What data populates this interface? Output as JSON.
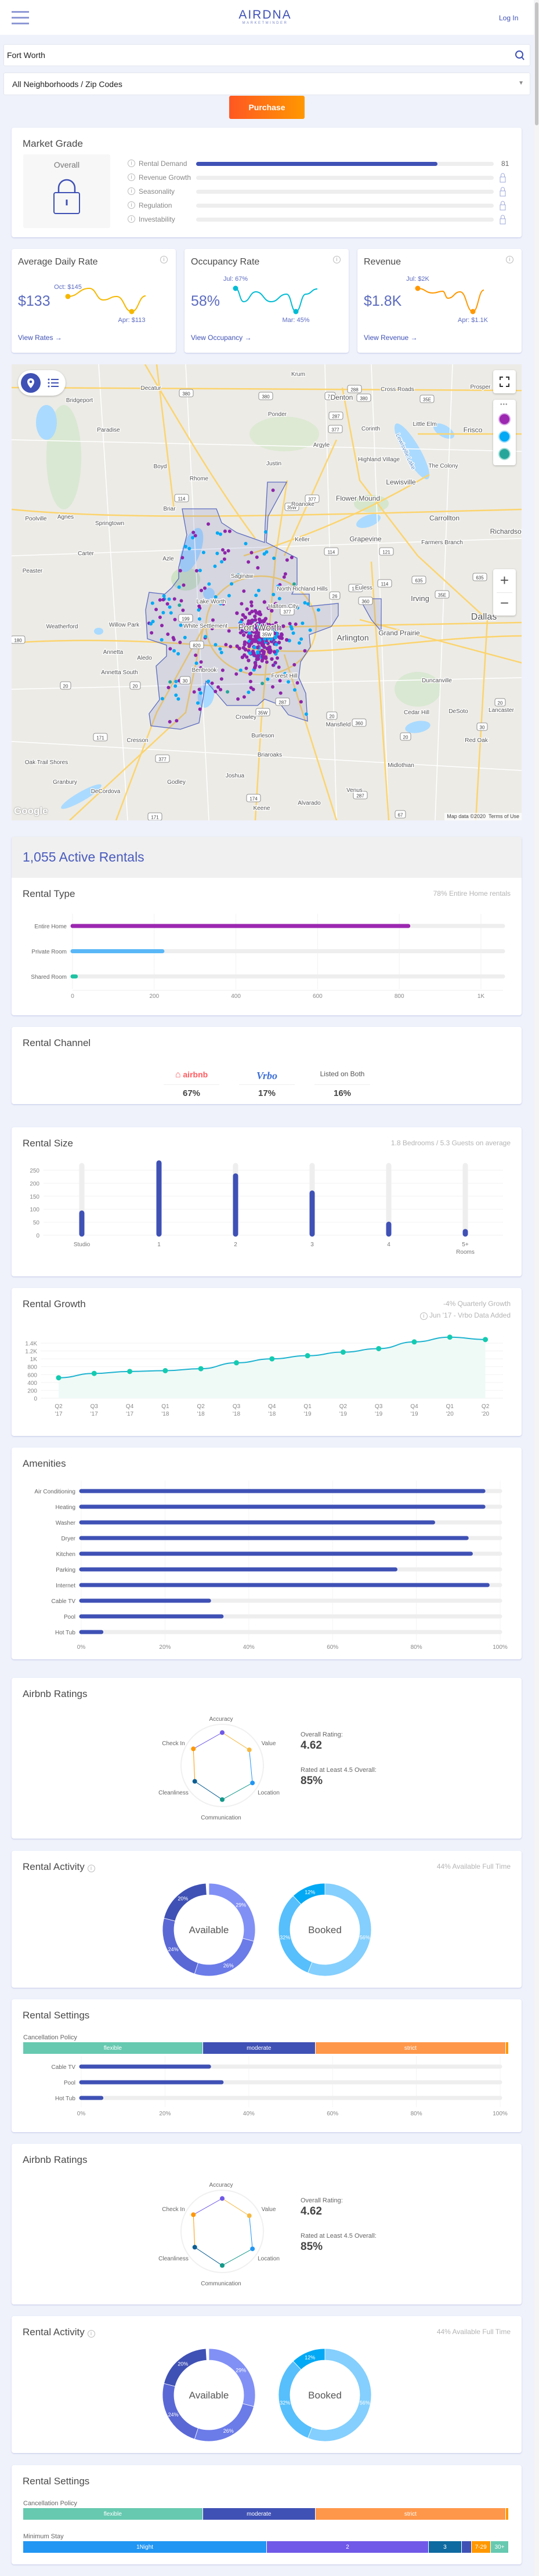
{
  "header": {
    "logo": "AIRDNA",
    "logo_sub": "MARKETMINDER",
    "login": "Log In"
  },
  "search": {
    "value": "Fort Worth"
  },
  "neighborhood": {
    "selected": "All Neighborhoods / Zip Codes"
  },
  "purchase": "Purchase",
  "market_grade": {
    "title": "Market Grade",
    "overall_label": "Overall",
    "rows": [
      {
        "label": "Rental Demand",
        "value": 81,
        "display": "81"
      },
      {
        "label": "Revenue Growth",
        "locked": true
      },
      {
        "label": "Seasonality",
        "locked": true
      },
      {
        "label": "Regulation",
        "locked": true
      },
      {
        "label": "Investability",
        "locked": true
      }
    ]
  },
  "stats": [
    {
      "title": "Average Daily Rate",
      "value": "$133",
      "high": "Oct: $145",
      "low": "Apr: $113",
      "link": "View Rates →",
      "color": "#f5b800"
    },
    {
      "title": "Occupancy Rate",
      "value": "58%",
      "high": "Jul: 67%",
      "low": "Mar: 45%",
      "link": "View Occupancy →",
      "color": "#00bcd4"
    },
    {
      "title": "Revenue",
      "value": "$1.8K",
      "high": "Jul: $2K",
      "low": "Apr: $1.1K",
      "link": "View Revenue →",
      "color": "#ff9800"
    }
  ],
  "map": {
    "labels": [
      "Krum",
      "Decatur",
      "Bridgeport",
      "Denton",
      "Cross Roads",
      "Prosper",
      "Ponder",
      "Corinth",
      "Little Elm",
      "Frisco",
      "Paradise",
      "Argyle",
      "Highland Village",
      "The Colony",
      "Boyd",
      "Justin",
      "Rhome",
      "Lewisville",
      "Flower Mound",
      "Roanoke",
      "Briar",
      "Poolville",
      "Agnes",
      "Springtown",
      "Carrollton",
      "Keller",
      "Grapevine",
      "Farmers Branch",
      "Richardson",
      "Carter",
      "Azle",
      "Peaster",
      "Saginaw",
      "North Richland Hills",
      "Euless",
      "Irving",
      "Lake Worth",
      "Haltom City",
      "Weatherford",
      "Willow Park",
      "White Settlement",
      "Fort Worth",
      "Arlington",
      "Grand Prairie",
      "Dallas",
      "Annetta",
      "Aledo",
      "Benbrook",
      "Annetta South",
      "Forest Hill",
      "Duncanville",
      "Cedar Hill",
      "DeSoto",
      "Lancaster",
      "Crowley",
      "Mansfield",
      "Burleson",
      "Cresson",
      "Red Oak",
      "Briaroaks",
      "Midlothian",
      "Oak Trail Shores",
      "Granbury",
      "Joshua",
      "Godley",
      "DeCordova",
      "Venus",
      "Keene",
      "Alvarado",
      "Lewisville Lake"
    ],
    "shields": [
      "380",
      "380",
      "77",
      "288",
      "380",
      "35E",
      "377",
      "287",
      "114",
      "377",
      "35W",
      "114",
      "121",
      "26",
      "121",
      "360",
      "635",
      "114",
      "35E",
      "635",
      "199",
      "35W",
      "377",
      "180",
      "20",
      "20",
      "820",
      "30",
      "287",
      "35W",
      "20",
      "20",
      "360",
      "30",
      "20",
      "171",
      "377",
      "174",
      "171",
      "287",
      "67",
      "377",
      "67",
      "35E"
    ],
    "attribution": "Map data ©2020",
    "terms": "Terms of Use",
    "google": "Google",
    "dot_colors": {
      "entire_home": "#8e24aa",
      "private_room": "#03a9f4",
      "shared_room": "#26a69a"
    }
  },
  "active_rentals": {
    "title": "1,055 Active Rentals"
  },
  "rental_type": {
    "title": "Rental Type",
    "subtitle": "78% Entire Home rentals",
    "chart_data": {
      "type": "bar",
      "categories": [
        "Entire Home",
        "Private Room",
        "Shared Room"
      ],
      "values": [
        822,
        220,
        8
      ],
      "colors": [
        "#9c27b0",
        "#5ab7f7",
        "#1fc2a3"
      ],
      "ticks": [
        "0",
        "200",
        "400",
        "600",
        "800",
        "1K"
      ],
      "tick_values": [
        0,
        200,
        400,
        600,
        800,
        1000
      ],
      "xlim": [
        0,
        1055
      ]
    }
  },
  "rental_channel": {
    "title": "Rental Channel",
    "items": [
      {
        "label": "airbnb",
        "value": "67%"
      },
      {
        "label": "Vrbo",
        "value": "17%"
      },
      {
        "label": "Listed on Both",
        "value": "16%"
      }
    ]
  },
  "rental_size": {
    "title": "Rental Size",
    "subtitle": "1.8 Bedrooms / 5.3 Guests on average",
    "chart_data": {
      "type": "bar",
      "categories": [
        "Studio",
        "1",
        "2",
        "3",
        "4",
        "5+ Rooms"
      ],
      "values": [
        85,
        278,
        228,
        162,
        42,
        14
      ],
      "ylim": [
        0,
        278
      ],
      "yticks": [
        0,
        50,
        100,
        150,
        200,
        250
      ]
    }
  },
  "rental_growth": {
    "title": "Rental Growth",
    "subtitle": "-4% Quarterly Growth",
    "note": "Jun '17 - Vrbo Data Added",
    "chart_data": {
      "type": "area",
      "x": [
        "Q2 '17",
        "Q3 '17",
        "Q4 '17",
        "Q1 '18",
        "Q2 '18",
        "Q3 '18",
        "Q4 '18",
        "Q1 '19",
        "Q2 '19",
        "Q3 '19",
        "Q4 '19",
        "Q1 '20",
        "Q2 '20"
      ],
      "values": [
        520,
        630,
        680,
        700,
        750,
        900,
        1000,
        1080,
        1170,
        1260,
        1430,
        1550,
        1490
      ],
      "yticks": [
        "0",
        "200",
        "400",
        "600",
        "800",
        "1K",
        "1.2K",
        "1.4K"
      ],
      "ytick_values": [
        0,
        200,
        400,
        600,
        800,
        1000,
        1200,
        1400
      ]
    }
  },
  "amenities": {
    "title": "Amenities",
    "chart_data": {
      "type": "bar",
      "categories": [
        "Air Conditioning",
        "Heating",
        "Washer",
        "Dryer",
        "Kitchen",
        "Parking",
        "Internet",
        "Cable TV",
        "Pool",
        "Hot Tub"
      ],
      "values": [
        96,
        96,
        84,
        92,
        93,
        75,
        97,
        30.5,
        33.5,
        4.8
      ],
      "ticks": [
        "0%",
        "20%",
        "40%",
        "60%",
        "80%",
        "100%"
      ],
      "xlim": [
        0,
        100
      ]
    }
  },
  "ratings": {
    "title": "Airbnb Ratings",
    "overall_label": "Overall Rating:",
    "overall": "4.62",
    "pct_label": "Rated at Least 4.5 Overall:",
    "pct": "85%",
    "chart_data": {
      "type": "radar",
      "categories": [
        "Accuracy",
        "Value",
        "Location",
        "Communication",
        "Cleanliness",
        "Check In"
      ],
      "values": [
        4.81,
        4.77,
        4.86,
        4.84,
        4.78,
        4.82
      ],
      "range": [
        4,
        5
      ],
      "colors": [
        "#7059e8",
        "#f5b942",
        "#2196f3",
        "#14998a",
        "#0e5f93",
        "#ff9800"
      ]
    }
  },
  "rental_activity": {
    "title": "Rental Activity",
    "subtitle": "44% Available Full Time",
    "chart_data": [
      {
        "type": "pie",
        "label": "Available",
        "values": [
          29,
          26,
          24,
          20
        ],
        "labels": [
          "29%",
          "26%",
          "24%",
          "20%"
        ],
        "colors": [
          "#8190f5",
          "#6b7be8",
          "#5a68d6",
          "#3f51b5"
        ]
      },
      {
        "type": "pie",
        "label": "Booked",
        "values": [
          56,
          32,
          12
        ],
        "labels": [
          "56%",
          "32%",
          "12%"
        ],
        "colors": [
          "#84cffd",
          "#56bffc",
          "#03a9f4"
        ]
      }
    ]
  },
  "rental_settings": {
    "title": "Rental Settings",
    "cancel_label": "Cancellation Policy",
    "cancel": [
      {
        "label": "flexible",
        "value": 37,
        "color": "#66c9b0"
      },
      {
        "label": "moderate",
        "value": 23.2,
        "color": "#3f51b5"
      },
      {
        "label": "strict",
        "value": 39.2,
        "color": "#ff974a"
      },
      {
        "label": "",
        "value": 0.6,
        "color": "#ff9800"
      }
    ],
    "amenities": {
      "categories": [
        "Cable TV",
        "Pool",
        "Hot Tub"
      ],
      "values": [
        30.5,
        33.5,
        4.8
      ],
      "ticks": [
        "0%",
        "20%",
        "40%",
        "60%",
        "80%",
        "100%"
      ]
    },
    "min_stay_label": "Minimum Stay",
    "min_stay": [
      {
        "label": "1Night",
        "value": 50.2,
        "color": "#2196f3"
      },
      {
        "label": "2",
        "value": 33.3,
        "color": "#7059e8"
      },
      {
        "label": "3",
        "value": 6.8,
        "color": "#0e6aa0"
      },
      {
        "label": "",
        "value": 2,
        "color": "#3f51b5"
      },
      {
        "label": "7-29",
        "value": 4,
        "color": "#ff9800"
      },
      {
        "label": "30+",
        "value": 3.7,
        "color": "#66c9b0"
      }
    ]
  }
}
